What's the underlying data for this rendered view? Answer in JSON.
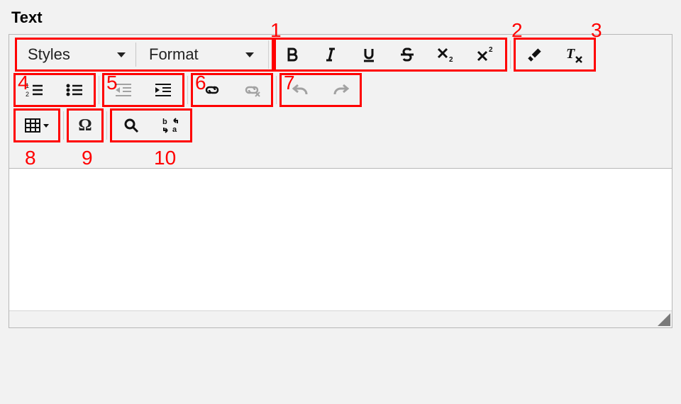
{
  "section": {
    "title": "Text"
  },
  "toolbar": {
    "styles_label": "Styles",
    "format_label": "Format"
  },
  "annotations": {
    "a1": "1",
    "a2": "2",
    "a3": "3",
    "a4": "4",
    "a5": "5",
    "a6": "6",
    "a7": "7",
    "a8": "8",
    "a9": "9",
    "a10": "10"
  }
}
